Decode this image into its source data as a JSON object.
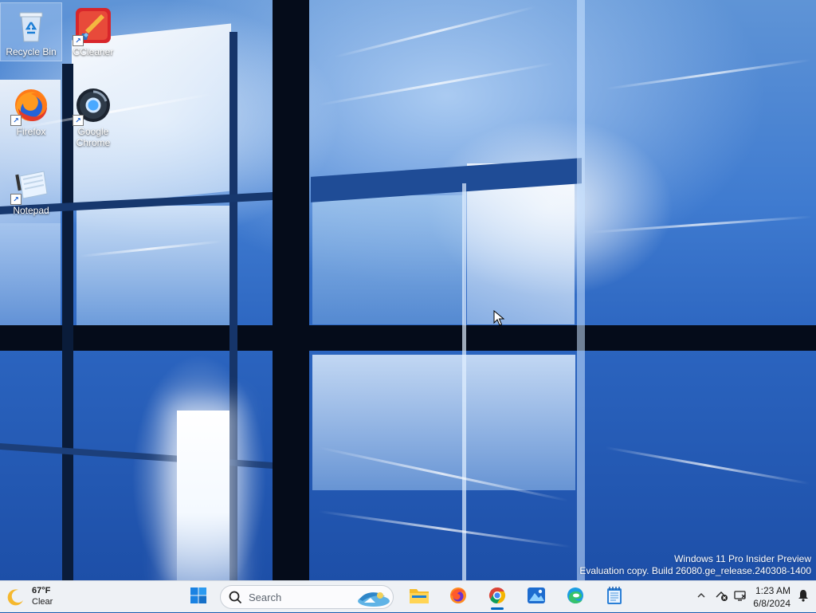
{
  "desktop": {
    "icons": [
      {
        "label": "Recycle Bin",
        "icon": "recycle-bin-icon"
      },
      {
        "label": "CCleaner",
        "icon": "ccleaner-icon"
      },
      {
        "label": "Firefox",
        "icon": "firefox-icon"
      },
      {
        "label": "Google Chrome",
        "icon": "chrome-icon"
      },
      {
        "label": "Notepad",
        "icon": "notepad-icon"
      }
    ],
    "watermark": {
      "line1": "Windows 11 Pro Insider Preview",
      "line2": "Evaluation copy. Build 26080.ge_release.240308-1400"
    }
  },
  "taskbar": {
    "weather": {
      "temp": "67°F",
      "condition": "Clear",
      "icon": "moon-icon"
    },
    "search": {
      "placeholder": "Search"
    },
    "apps": [
      {
        "name": "Start",
        "icon": "windows-start-icon"
      },
      {
        "name": "File Explorer",
        "icon": "file-explorer-icon"
      },
      {
        "name": "Firefox",
        "icon": "firefox-icon"
      },
      {
        "name": "Google Chrome",
        "icon": "chrome-icon"
      },
      {
        "name": "Photos",
        "icon": "photos-icon"
      },
      {
        "name": "Microsoft Edge",
        "icon": "edge-icon"
      },
      {
        "name": "Notepad",
        "icon": "notepad-icon"
      }
    ],
    "clock": {
      "time": "1:23 AM",
      "date": "6/8/2024"
    },
    "tray": [
      "chevron-up-icon",
      "network-disconnected-icon",
      "speaker-icon",
      "notification-bell-icon"
    ]
  },
  "colors": {
    "accent": "#0067c0",
    "taskbar_bg": "#eef1f5",
    "wallpaper_blue": "#2b64bf"
  }
}
